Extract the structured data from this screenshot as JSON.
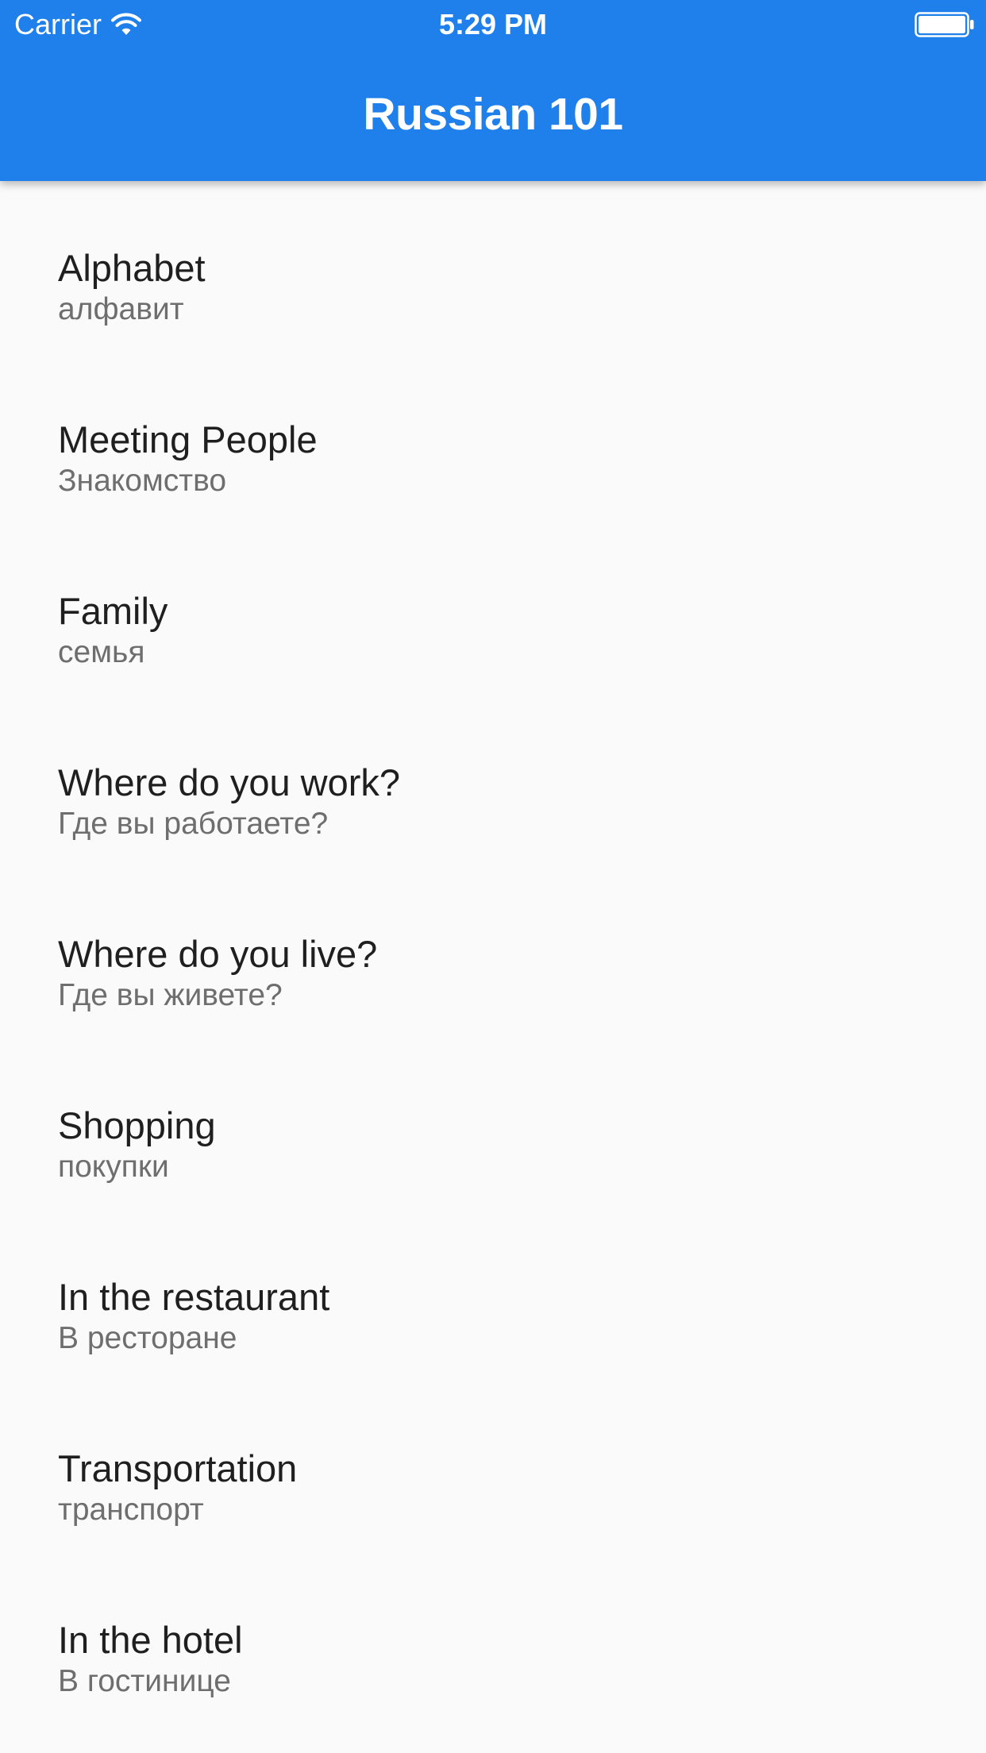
{
  "status_bar": {
    "carrier": "Carrier",
    "time": "5:29 PM"
  },
  "app_bar": {
    "title": "Russian 101"
  },
  "lessons": [
    {
      "title": "Alphabet",
      "subtitle": "алфавит"
    },
    {
      "title": "Meeting People",
      "subtitle": "Знакомство"
    },
    {
      "title": "Family",
      "subtitle": "семья"
    },
    {
      "title": "Where do you work?",
      "subtitle": "Где вы работаете?"
    },
    {
      "title": "Where do you live?",
      "subtitle": "Где вы живете?"
    },
    {
      "title": "Shopping",
      "subtitle": "покупки"
    },
    {
      "title": "In the restaurant",
      "subtitle": "В ресторане"
    },
    {
      "title": "Transportation",
      "subtitle": "транспорт"
    },
    {
      "title": "In the hotel",
      "subtitle": "В гостинице"
    }
  ],
  "icons": {
    "wifi": "wifi-icon",
    "battery": "battery-icon"
  },
  "colors": {
    "app_bar": "#1f80eb",
    "background": "#fafafa",
    "title_text": "#1f1f1f",
    "subtitle_text": "#6e6e6e"
  }
}
